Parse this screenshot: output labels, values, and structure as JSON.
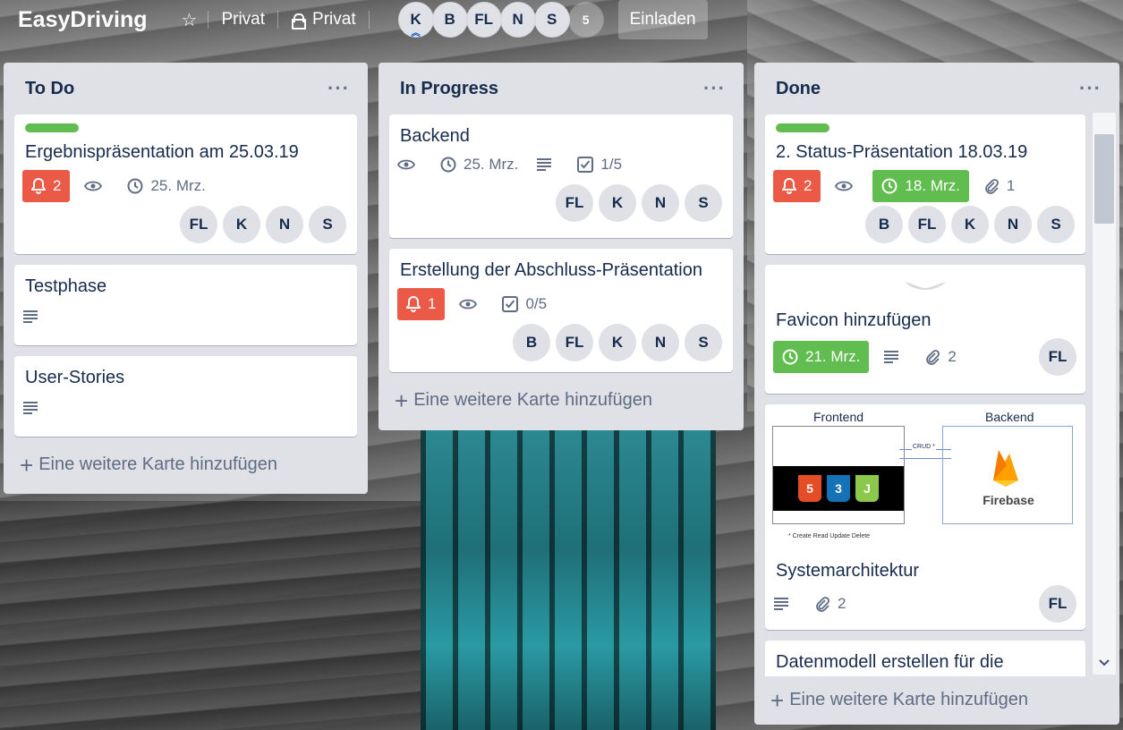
{
  "header": {
    "board_title": "EasyDriving",
    "visibility_1": "Privat",
    "visibility_2": "Privat",
    "members": [
      "K",
      "B",
      "FL",
      "N",
      "S"
    ],
    "member_more": "5",
    "invite_label": "Einladen"
  },
  "colors": {
    "label_green": "#61bd4f",
    "due_red": "#eb5a46",
    "due_green": "#61bd4f",
    "list_bg": "#dfe1e6"
  },
  "lists": [
    {
      "title": "To Do",
      "add_card": "Eine weitere Karte hinzufügen",
      "cards": [
        {
          "title": "Ergebnispräsentation am 25.03.19",
          "has_label": true,
          "notifications": "2",
          "due": "25. Mrz.",
          "members": [
            "FL",
            "K",
            "N",
            "S"
          ]
        },
        {
          "title": "Testphase"
        },
        {
          "title": "User-Stories"
        }
      ]
    },
    {
      "title": "In Progress",
      "add_card": "Eine weitere Karte hinzufügen",
      "cards": [
        {
          "title": "Backend",
          "due": "25. Mrz.",
          "checklist": "1/5",
          "members": [
            "FL",
            "K",
            "N",
            "S"
          ]
        },
        {
          "title": "Erstellung der Abschluss-Präsentation",
          "notifications": "1",
          "checklist": "0/5",
          "members": [
            "B",
            "FL",
            "K",
            "N",
            "S"
          ]
        }
      ]
    },
    {
      "title": "Done",
      "add_card": "Eine weitere Karte hinzufügen",
      "cards": [
        {
          "title": "2. Status-Präsentation 18.03.19",
          "has_label": true,
          "notifications": "2",
          "due": "18. Mrz.",
          "attachments": "1",
          "members": [
            "B",
            "FL",
            "K",
            "N",
            "S"
          ]
        },
        {
          "title": "Favicon hinzufügen",
          "due": "21. Mrz.",
          "attachments": "2",
          "members": [
            "FL"
          ]
        },
        {
          "title": "Systemarchitektur",
          "attachments": "2",
          "members": [
            "FL"
          ],
          "diagram": {
            "frontend_label": "Frontend",
            "backend_label": "Backend",
            "crud_label": "CRUD *",
            "footnote": "* Create Read Update Delete",
            "firebase_label": "Firebase",
            "tech_icons": [
              "5",
              "3",
              "J"
            ]
          }
        },
        {
          "title": "Datenmodell erstellen für die"
        }
      ]
    }
  ]
}
